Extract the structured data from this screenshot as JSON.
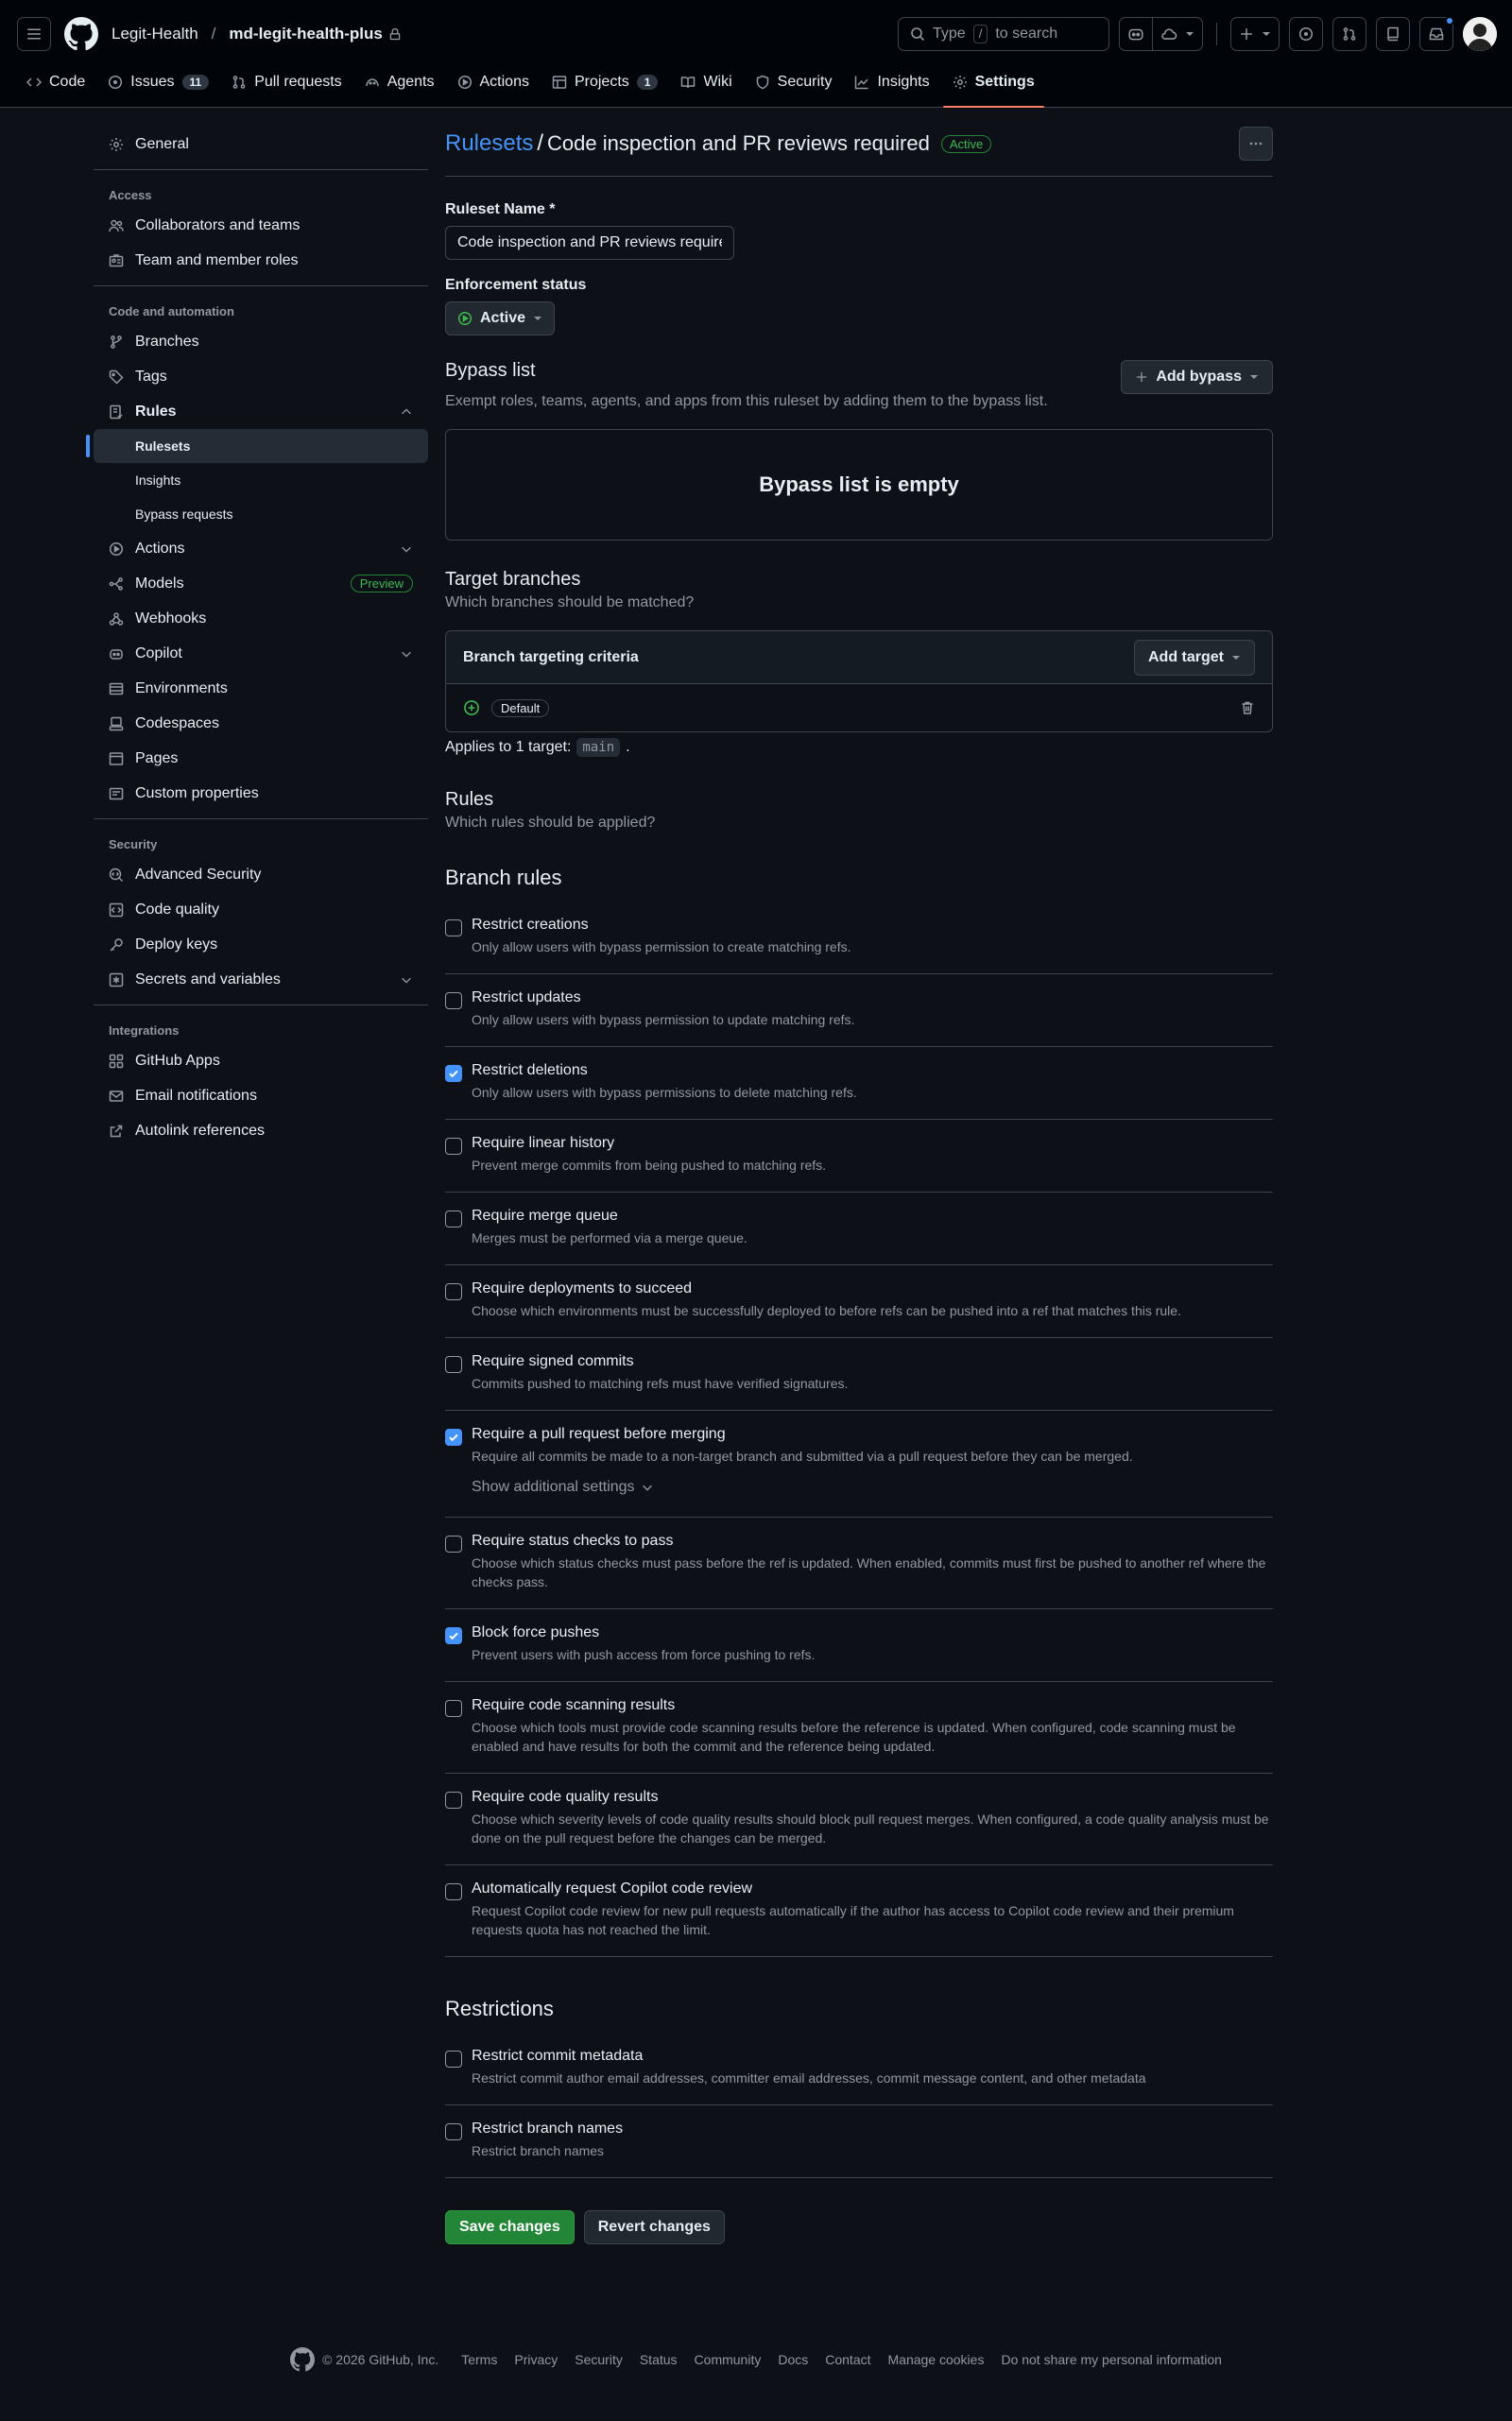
{
  "header": {
    "owner": "Legit-Health",
    "separator": "/",
    "repo": "md-legit-health-plus",
    "search_label": "Type",
    "search_key": "/",
    "search_suffix": "to search"
  },
  "tabs": [
    {
      "label": "Code",
      "icon": "code-icon"
    },
    {
      "label": "Issues",
      "count": "11",
      "icon": "issue-icon"
    },
    {
      "label": "Pull requests",
      "icon": "pull-request-icon"
    },
    {
      "label": "Agents",
      "icon": "agent-icon"
    },
    {
      "label": "Actions",
      "icon": "play-icon"
    },
    {
      "label": "Projects",
      "count": "1",
      "icon": "table-icon"
    },
    {
      "label": "Wiki",
      "icon": "book-icon"
    },
    {
      "label": "Security",
      "icon": "shield-icon"
    },
    {
      "label": "Insights",
      "icon": "graph-icon"
    },
    {
      "label": "Settings",
      "icon": "gear-icon",
      "active": true
    }
  ],
  "sidebar": {
    "general": "General",
    "access_heading": "Access",
    "collaborators": "Collaborators and teams",
    "team_roles": "Team and member roles",
    "code_heading": "Code and automation",
    "branches": "Branches",
    "tags": "Tags",
    "rules": "Rules",
    "rulesets": "Rulesets",
    "insights": "Insights",
    "bypass_requests": "Bypass requests",
    "actions": "Actions",
    "models": "Models",
    "models_badge": "Preview",
    "webhooks": "Webhooks",
    "copilot": "Copilot",
    "environments": "Environments",
    "codespaces": "Codespaces",
    "pages": "Pages",
    "custom_properties": "Custom properties",
    "security_heading": "Security",
    "advanced_security": "Advanced Security",
    "code_quality": "Code quality",
    "deploy_keys": "Deploy keys",
    "secrets": "Secrets and variables",
    "integrations_heading": "Integrations",
    "github_apps": "GitHub Apps",
    "email_notifications": "Email notifications",
    "autolink": "Autolink references"
  },
  "main": {
    "breadcrumb_link": "Rulesets",
    "breadcrumb_sep": "/",
    "ruleset_title": "Code inspection and PR reviews required",
    "status_badge": "Active",
    "ruleset_name_label": "Ruleset Name *",
    "ruleset_name_value": "Code inspection and PR reviews required",
    "enforcement_label": "Enforcement status",
    "enforcement_value": "Active",
    "bypass_title": "Bypass list",
    "bypass_desc": "Exempt roles, teams, agents, and apps from this ruleset by adding them to the bypass list.",
    "add_bypass": "Add bypass",
    "bypass_empty": "Bypass list is empty",
    "target_title": "Target branches",
    "target_desc": "Which branches should be matched?",
    "criteria_title": "Branch targeting criteria",
    "add_target": "Add target",
    "criteria_default": "Default",
    "applies_prefix": "Applies to 1 target:",
    "applies_target": "main",
    "applies_suffix": ".",
    "rules_title": "Rules",
    "rules_desc": "Which rules should be applied?",
    "branch_rules_title": "Branch rules",
    "show_additional": "Show additional settings",
    "restrictions_title": "Restrictions",
    "save": "Save changes",
    "revert": "Revert changes"
  },
  "branch_rules": [
    {
      "title": "Restrict creations",
      "desc": "Only allow users with bypass permission to create matching refs.",
      "checked": false
    },
    {
      "title": "Restrict updates",
      "desc": "Only allow users with bypass permission to update matching refs.",
      "checked": false
    },
    {
      "title": "Restrict deletions",
      "desc": "Only allow users with bypass permissions to delete matching refs.",
      "checked": true
    },
    {
      "title": "Require linear history",
      "desc": "Prevent merge commits from being pushed to matching refs.",
      "checked": false
    },
    {
      "title": "Require merge queue",
      "desc": "Merges must be performed via a merge queue.",
      "checked": false
    },
    {
      "title": "Require deployments to succeed",
      "desc": "Choose which environments must be successfully deployed to before refs can be pushed into a ref that matches this rule.",
      "checked": false
    },
    {
      "title": "Require signed commits",
      "desc": "Commits pushed to matching refs must have verified signatures.",
      "checked": false
    },
    {
      "title": "Require a pull request before merging",
      "desc": "Require all commits be made to a non-target branch and submitted via a pull request before they can be merged.",
      "checked": true
    },
    {
      "title": "Require status checks to pass",
      "desc": "Choose which status checks must pass before the ref is updated. When enabled, commits must first be pushed to another ref where the checks pass.",
      "checked": false
    },
    {
      "title": "Block force pushes",
      "desc": "Prevent users with push access from force pushing to refs.",
      "checked": true
    },
    {
      "title": "Require code scanning results",
      "desc": "Choose which tools must provide code scanning results before the reference is updated. When configured, code scanning must be enabled and have results for both the commit and the reference being updated.",
      "checked": false
    },
    {
      "title": "Require code quality results",
      "desc": "Choose which severity levels of code quality results should block pull request merges. When configured, a code quality analysis must be done on the pull request before the changes can be merged.",
      "checked": false
    },
    {
      "title": "Automatically request Copilot code review",
      "desc": "Request Copilot code review for new pull requests automatically if the author has access to Copilot code review and their premium requests quota has not reached the limit.",
      "checked": false
    }
  ],
  "restrictions": [
    {
      "title": "Restrict commit metadata",
      "desc": "Restrict commit author email addresses, committer email addresses, commit message content, and other metadata",
      "checked": false
    },
    {
      "title": "Restrict branch names",
      "desc": "Restrict branch names",
      "checked": false
    }
  ],
  "footer": {
    "copyright": "© 2026 GitHub, Inc.",
    "links": [
      "Terms",
      "Privacy",
      "Security",
      "Status",
      "Community",
      "Docs",
      "Contact",
      "Manage cookies",
      "Do not share my personal information"
    ]
  },
  "colors": {
    "accent": "#4493f8",
    "success": "#238636",
    "underline": "#f78166",
    "background": "#0d1117"
  }
}
